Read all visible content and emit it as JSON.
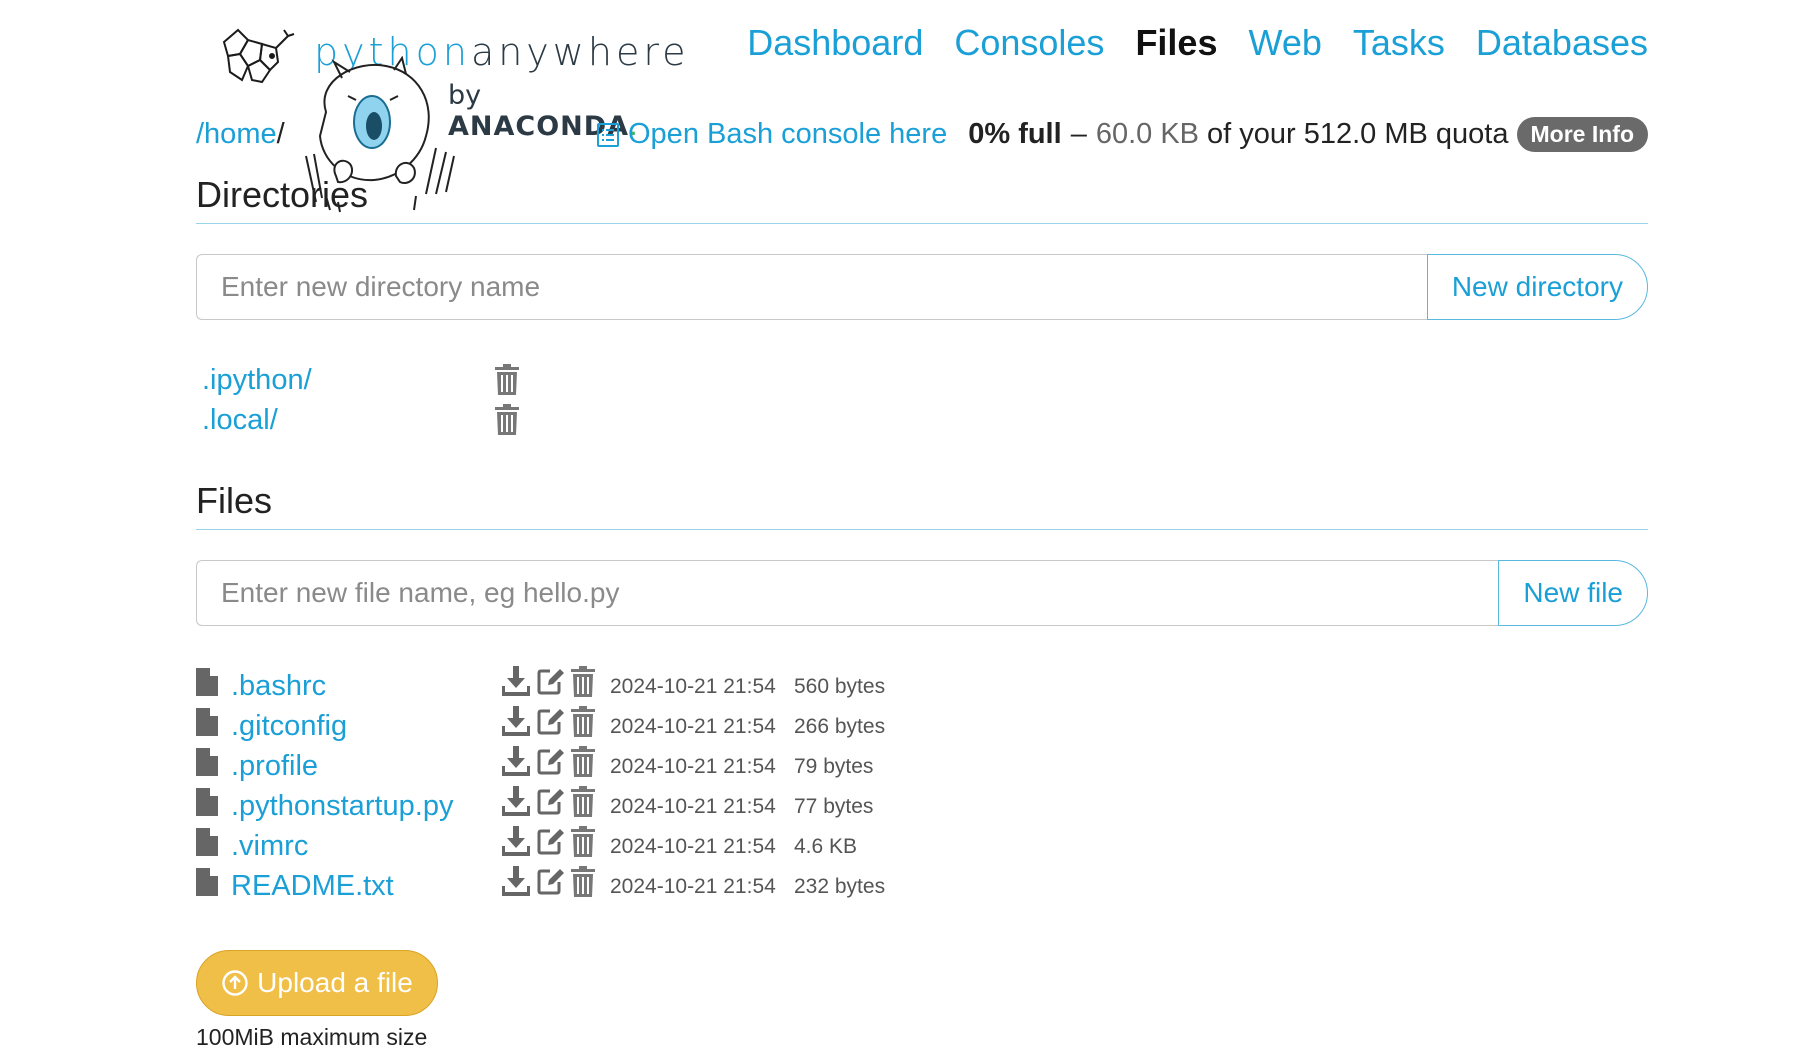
{
  "brand": {
    "word_python": "python",
    "word_anywhere": "anywhere",
    "by": "by",
    "anaconda": "ANACONDA",
    "anaconda_dot": "."
  },
  "nav": {
    "dashboard": "Dashboard",
    "consoles": "Consoles",
    "files": "Files",
    "web": "Web",
    "tasks": "Tasks",
    "databases": "Databases",
    "active": "Files"
  },
  "path": {
    "home": "/home",
    "sep": "/"
  },
  "bash_console": {
    "label": "Open Bash console here",
    "icon": "console-list-icon"
  },
  "quota": {
    "percent": "0% full",
    "dash": "–",
    "used": "60.0 KB",
    "of_text": "of your 512.0 MB quota",
    "more_info": "More Info"
  },
  "directories": {
    "title": "Directories",
    "placeholder": "Enter new directory name",
    "button": "New directory",
    "items": [
      {
        "name": ".ipython/"
      },
      {
        "name": ".local/"
      }
    ]
  },
  "files": {
    "title": "Files",
    "placeholder": "Enter new file name, eg hello.py",
    "button": "New file",
    "items": [
      {
        "name": ".bashrc",
        "modified": "2024-10-21 21:54",
        "size": "560 bytes"
      },
      {
        "name": ".gitconfig",
        "modified": "2024-10-21 21:54",
        "size": "266 bytes"
      },
      {
        "name": ".profile",
        "modified": "2024-10-21 21:54",
        "size": "79 bytes"
      },
      {
        "name": ".pythonstartup.py",
        "modified": "2024-10-21 21:54",
        "size": "77 bytes"
      },
      {
        "name": ".vimrc",
        "modified": "2024-10-21 21:54",
        "size": "4.6 KB"
      },
      {
        "name": "README.txt",
        "modified": "2024-10-21 21:54",
        "size": "232 bytes"
      }
    ]
  },
  "upload": {
    "label": "Upload a file",
    "note": "100MiB maximum size",
    "color": "#f0bf48"
  },
  "colors": {
    "link": "#1a9fd6",
    "rule": "#9bd3ea",
    "badge": "#6a6a6a"
  }
}
